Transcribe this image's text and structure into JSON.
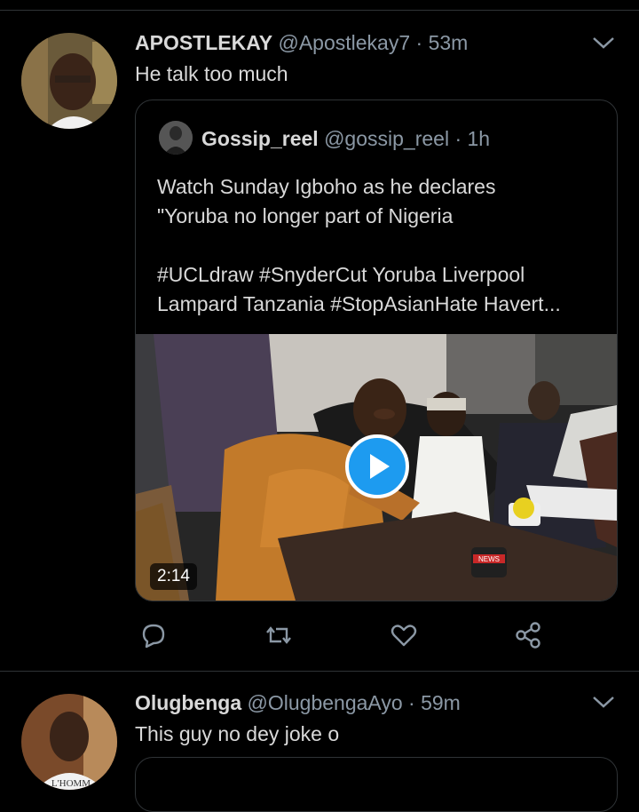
{
  "tweets": [
    {
      "name": "APOSTLEKAY",
      "handle": "@Apostlekay7",
      "sep": " · ",
      "time": "53m",
      "text": "He talk too much",
      "quote": {
        "name": "Gossip_reel",
        "handle": "@gossip_reel",
        "sep": " · ",
        "time": "1h",
        "text": "Watch Sunday Igboho as he declares\n\"Yoruba no longer part of Nigeria\n\n#UCLdraw #SnyderCut Yoruba Liverpool\nLampard Tanzania #StopAsianHate Havert...",
        "duration": "2:14",
        "mic_label": "NEWS"
      },
      "actions": [
        "reply-icon",
        "retweet-icon",
        "like-icon",
        "share-icon"
      ]
    },
    {
      "name": "Olugbenga",
      "handle": "@OlugbengaAyo",
      "sep": " · ",
      "time": "59m",
      "text": "This guy no dey joke o",
      "shirt_text": "L'HOMM"
    }
  ],
  "colors": {
    "background": "#000000",
    "text": "#d9d9d9",
    "muted": "#8b98a5",
    "accent": "#1d9bf0",
    "border": "#2f3336"
  }
}
